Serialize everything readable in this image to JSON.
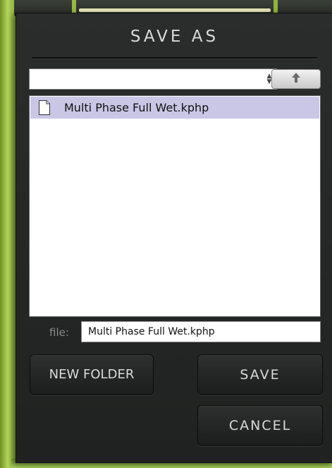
{
  "dialog": {
    "title": "SAVE AS",
    "path_select": {
      "value": ""
    },
    "up_button": {
      "icon": "arrow-up-icon"
    },
    "files": [
      {
        "name": "Multi Phase Full Wet.kphp",
        "icon": "file-icon",
        "selected": true
      }
    ],
    "file_field": {
      "label": "file:",
      "value": "Multi Phase Full Wet.kphp"
    },
    "buttons": {
      "new_folder": "NEW FOLDER",
      "save": "SAVE",
      "cancel": "CANCEL"
    }
  },
  "colors": {
    "background_green": "#8fb23c",
    "dialog_bg": "#252727",
    "selection": "#c9c6e6",
    "text_light": "#dadada"
  }
}
